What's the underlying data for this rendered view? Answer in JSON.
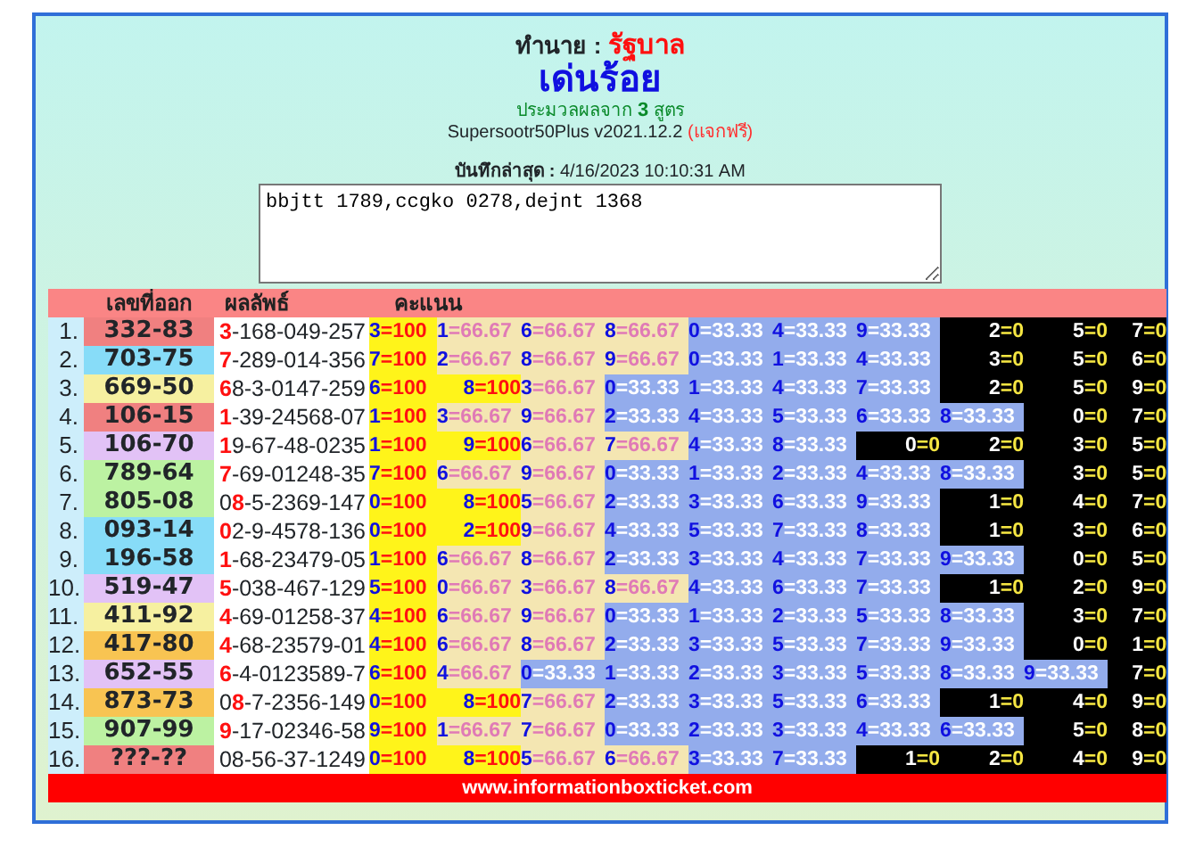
{
  "header": {
    "label": "ทำนาย :",
    "value": "รัฐบาล"
  },
  "title": "เด่นร้อย",
  "subtitle": "ประมวลผลจาก **3** สูตร",
  "version": "Supersootr50Plus v2021.12.2",
  "version_note": "(แจกฟรี)",
  "saved": {
    "label": "บันทึกล่าสุด :",
    "value": "4/16/2023 10:10:31 AM"
  },
  "notes": {
    "value": "bbjtt 1789,ccgko 0278,dejnt 1368"
  },
  "table": {
    "columns": [
      "เลขที่ออก",
      "ผลลัพธ์",
      "คะแนน"
    ],
    "rows": [
      {
        "index": "1.",
        "number": "332-83",
        "color": "#f08080",
        "result": "**3**-168-049-257",
        "scores": [
          {
            "text": "3=100",
            "kind": "full"
          },
          {
            "text": "1=66.67",
            "kind": "high"
          },
          {
            "text": "6=66.67",
            "kind": "high"
          },
          {
            "text": "8=66.67",
            "kind": "high"
          },
          {
            "text": "0=33.33",
            "kind": "mid"
          },
          {
            "text": "4=33.33",
            "kind": "mid"
          },
          {
            "text": "9=33.33",
            "kind": "mid"
          },
          {
            "text": "2=0",
            "kind": "zero"
          },
          {
            "text": "5=0",
            "kind": "zero"
          },
          {
            "text": "7=0",
            "kind": "zero"
          }
        ]
      },
      {
        "index": "2.",
        "number": "703-75",
        "color": "#87dcf8",
        "result": "**7**-289-014-356",
        "scores": [
          {
            "text": "7=100",
            "kind": "full"
          },
          {
            "text": "2=66.67",
            "kind": "high"
          },
          {
            "text": "8=66.67",
            "kind": "high"
          },
          {
            "text": "9=66.67",
            "kind": "high"
          },
          {
            "text": "0=33.33",
            "kind": "mid"
          },
          {
            "text": "1=33.33",
            "kind": "mid"
          },
          {
            "text": "4=33.33",
            "kind": "mid"
          },
          {
            "text": "3=0",
            "kind": "zero"
          },
          {
            "text": "5=0",
            "kind": "zero"
          },
          {
            "text": "6=0",
            "kind": "zero"
          }
        ]
      },
      {
        "index": "3.",
        "number": "669-50",
        "color": "#f6f0a0",
        "result": "**6**8-3-0147-259",
        "scores": [
          {
            "text": "6=100",
            "kind": "full"
          },
          {
            "text": "8=100",
            "kind": "full"
          },
          {
            "text": "3=66.67",
            "kind": "high"
          },
          {
            "text": "0=33.33",
            "kind": "mid"
          },
          {
            "text": "1=33.33",
            "kind": "mid"
          },
          {
            "text": "4=33.33",
            "kind": "mid"
          },
          {
            "text": "7=33.33",
            "kind": "mid"
          },
          {
            "text": "2=0",
            "kind": "zero"
          },
          {
            "text": "5=0",
            "kind": "zero"
          },
          {
            "text": "9=0",
            "kind": "zero"
          }
        ]
      },
      {
        "index": "4.",
        "number": "106-15",
        "color": "#f08080",
        "result": "**1**-39-24568-07",
        "scores": [
          {
            "text": "1=100",
            "kind": "full"
          },
          {
            "text": "3=66.67",
            "kind": "high"
          },
          {
            "text": "9=66.67",
            "kind": "high"
          },
          {
            "text": "2=33.33",
            "kind": "mid"
          },
          {
            "text": "4=33.33",
            "kind": "mid"
          },
          {
            "text": "5=33.33",
            "kind": "mid"
          },
          {
            "text": "6=33.33",
            "kind": "mid"
          },
          {
            "text": "8=33.33",
            "kind": "mid"
          },
          {
            "text": "0=0",
            "kind": "zero"
          },
          {
            "text": "7=0",
            "kind": "zero"
          }
        ]
      },
      {
        "index": "5.",
        "number": "106-70",
        "color": "#e2c2f6",
        "result": "**1**9-67-48-0235",
        "scores": [
          {
            "text": "1=100",
            "kind": "full"
          },
          {
            "text": "9=100",
            "kind": "full"
          },
          {
            "text": "6=66.67",
            "kind": "high"
          },
          {
            "text": "7=66.67",
            "kind": "high"
          },
          {
            "text": "4=33.33",
            "kind": "mid"
          },
          {
            "text": "8=33.33",
            "kind": "mid"
          },
          {
            "text": "0=0",
            "kind": "zero"
          },
          {
            "text": "2=0",
            "kind": "zero"
          },
          {
            "text": "3=0",
            "kind": "zero"
          },
          {
            "text": "5=0",
            "kind": "zero"
          }
        ]
      },
      {
        "index": "6.",
        "number": "789-64",
        "color": "#bcf2a2",
        "result": "**7**-69-01248-35",
        "scores": [
          {
            "text": "7=100",
            "kind": "full"
          },
          {
            "text": "6=66.67",
            "kind": "high"
          },
          {
            "text": "9=66.67",
            "kind": "high"
          },
          {
            "text": "0=33.33",
            "kind": "mid"
          },
          {
            "text": "1=33.33",
            "kind": "mid"
          },
          {
            "text": "2=33.33",
            "kind": "mid"
          },
          {
            "text": "4=33.33",
            "kind": "mid"
          },
          {
            "text": "8=33.33",
            "kind": "mid"
          },
          {
            "text": "3=0",
            "kind": "zero"
          },
          {
            "text": "5=0",
            "kind": "zero"
          }
        ]
      },
      {
        "index": "7.",
        "number": "805-08",
        "color": "#bcf2a2",
        "result": "0**8**-5-2369-147",
        "scores": [
          {
            "text": "0=100",
            "kind": "full"
          },
          {
            "text": "8=100",
            "kind": "full"
          },
          {
            "text": "5=66.67",
            "kind": "high"
          },
          {
            "text": "2=33.33",
            "kind": "mid"
          },
          {
            "text": "3=33.33",
            "kind": "mid"
          },
          {
            "text": "6=33.33",
            "kind": "mid"
          },
          {
            "text": "9=33.33",
            "kind": "mid"
          },
          {
            "text": "1=0",
            "kind": "zero"
          },
          {
            "text": "4=0",
            "kind": "zero"
          },
          {
            "text": "7=0",
            "kind": "zero"
          }
        ]
      },
      {
        "index": "8.",
        "number": "093-14",
        "color": "#87dcf8",
        "result": "**0**2-9-4578-136",
        "scores": [
          {
            "text": "0=100",
            "kind": "full"
          },
          {
            "text": "2=100",
            "kind": "full"
          },
          {
            "text": "9=66.67",
            "kind": "high"
          },
          {
            "text": "4=33.33",
            "kind": "mid"
          },
          {
            "text": "5=33.33",
            "kind": "mid"
          },
          {
            "text": "7=33.33",
            "kind": "mid"
          },
          {
            "text": "8=33.33",
            "kind": "mid"
          },
          {
            "text": "1=0",
            "kind": "zero"
          },
          {
            "text": "3=0",
            "kind": "zero"
          },
          {
            "text": "6=0",
            "kind": "zero"
          }
        ]
      },
      {
        "index": "9.",
        "number": "196-58",
        "color": "#87dcf8",
        "result": "**1**-68-23479-05",
        "scores": [
          {
            "text": "1=100",
            "kind": "full"
          },
          {
            "text": "6=66.67",
            "kind": "high"
          },
          {
            "text": "8=66.67",
            "kind": "high"
          },
          {
            "text": "2=33.33",
            "kind": "mid"
          },
          {
            "text": "3=33.33",
            "kind": "mid"
          },
          {
            "text": "4=33.33",
            "kind": "mid"
          },
          {
            "text": "7=33.33",
            "kind": "mid"
          },
          {
            "text": "9=33.33",
            "kind": "mid"
          },
          {
            "text": "0=0",
            "kind": "zero"
          },
          {
            "text": "5=0",
            "kind": "zero"
          }
        ]
      },
      {
        "index": "10.",
        "number": "519-47",
        "color": "#e2c2f6",
        "result": "**5**-038-467-129",
        "scores": [
          {
            "text": "5=100",
            "kind": "full"
          },
          {
            "text": "0=66.67",
            "kind": "high"
          },
          {
            "text": "3=66.67",
            "kind": "high"
          },
          {
            "text": "8=66.67",
            "kind": "high"
          },
          {
            "text": "4=33.33",
            "kind": "mid"
          },
          {
            "text": "6=33.33",
            "kind": "mid"
          },
          {
            "text": "7=33.33",
            "kind": "mid"
          },
          {
            "text": "1=0",
            "kind": "zero"
          },
          {
            "text": "2=0",
            "kind": "zero"
          },
          {
            "text": "9=0",
            "kind": "zero"
          }
        ]
      },
      {
        "index": "11.",
        "number": "411-92",
        "color": "#f6f0a0",
        "result": "**4**-69-01258-37",
        "scores": [
          {
            "text": "4=100",
            "kind": "full"
          },
          {
            "text": "6=66.67",
            "kind": "high"
          },
          {
            "text": "9=66.67",
            "kind": "high"
          },
          {
            "text": "0=33.33",
            "kind": "mid"
          },
          {
            "text": "1=33.33",
            "kind": "mid"
          },
          {
            "text": "2=33.33",
            "kind": "mid"
          },
          {
            "text": "5=33.33",
            "kind": "mid"
          },
          {
            "text": "8=33.33",
            "kind": "mid"
          },
          {
            "text": "3=0",
            "kind": "zero"
          },
          {
            "text": "7=0",
            "kind": "zero"
          }
        ]
      },
      {
        "index": "12.",
        "number": "417-80",
        "color": "#f8c452",
        "result": "**4**-68-23579-01",
        "scores": [
          {
            "text": "4=100",
            "kind": "full"
          },
          {
            "text": "6=66.67",
            "kind": "high"
          },
          {
            "text": "8=66.67",
            "kind": "high"
          },
          {
            "text": "2=33.33",
            "kind": "mid"
          },
          {
            "text": "3=33.33",
            "kind": "mid"
          },
          {
            "text": "5=33.33",
            "kind": "mid"
          },
          {
            "text": "7=33.33",
            "kind": "mid"
          },
          {
            "text": "9=33.33",
            "kind": "mid"
          },
          {
            "text": "0=0",
            "kind": "zero"
          },
          {
            "text": "1=0",
            "kind": "zero"
          }
        ]
      },
      {
        "index": "13.",
        "number": "652-55",
        "color": "#e2c2f6",
        "result": "**6**-4-0123589-7",
        "scores": [
          {
            "text": "6=100",
            "kind": "full"
          },
          {
            "text": "4=66.67",
            "kind": "high"
          },
          {
            "text": "0=33.33",
            "kind": "mid"
          },
          {
            "text": "1=33.33",
            "kind": "mid"
          },
          {
            "text": "2=33.33",
            "kind": "mid"
          },
          {
            "text": "3=33.33",
            "kind": "mid"
          },
          {
            "text": "5=33.33",
            "kind": "mid"
          },
          {
            "text": "8=33.33",
            "kind": "mid"
          },
          {
            "text": "9=33.33",
            "kind": "mid"
          },
          {
            "text": "7=0",
            "kind": "zero"
          }
        ]
      },
      {
        "index": "14.",
        "number": "873-73",
        "color": "#f8c452",
        "result": "0**8**-7-2356-149",
        "scores": [
          {
            "text": "0=100",
            "kind": "full"
          },
          {
            "text": "8=100",
            "kind": "full"
          },
          {
            "text": "7=66.67",
            "kind": "high"
          },
          {
            "text": "2=33.33",
            "kind": "mid"
          },
          {
            "text": "3=33.33",
            "kind": "mid"
          },
          {
            "text": "5=33.33",
            "kind": "mid"
          },
          {
            "text": "6=33.33",
            "kind": "mid"
          },
          {
            "text": "1=0",
            "kind": "zero"
          },
          {
            "text": "4=0",
            "kind": "zero"
          },
          {
            "text": "9=0",
            "kind": "zero"
          }
        ]
      },
      {
        "index": "15.",
        "number": "907-99",
        "color": "#bcf2a2",
        "result": "**9**-17-02346-58",
        "scores": [
          {
            "text": "9=100",
            "kind": "full"
          },
          {
            "text": "1=66.67",
            "kind": "high"
          },
          {
            "text": "7=66.67",
            "kind": "high"
          },
          {
            "text": "0=33.33",
            "kind": "mid"
          },
          {
            "text": "2=33.33",
            "kind": "mid"
          },
          {
            "text": "3=33.33",
            "kind": "mid"
          },
          {
            "text": "4=33.33",
            "kind": "mid"
          },
          {
            "text": "6=33.33",
            "kind": "mid"
          },
          {
            "text": "5=0",
            "kind": "zero"
          },
          {
            "text": "8=0",
            "kind": "zero"
          }
        ]
      },
      {
        "index": "16.",
        "number": "???-??",
        "color": "#f08080",
        "result": "08-56-37-1249",
        "scores": [
          {
            "text": "0=100",
            "kind": "full"
          },
          {
            "text": "8=100",
            "kind": "full"
          },
          {
            "text": "5=66.67",
            "kind": "high"
          },
          {
            "text": "6=66.67",
            "kind": "high"
          },
          {
            "text": "3=33.33",
            "kind": "mid"
          },
          {
            "text": "7=33.33",
            "kind": "mid"
          },
          {
            "text": "1=0",
            "kind": "zero"
          },
          {
            "text": "2=0",
            "kind": "zero"
          },
          {
            "text": "4=0",
            "kind": "zero"
          },
          {
            "text": "9=0",
            "kind": "zero"
          }
        ]
      }
    ]
  },
  "footer": "www.informationboxticket.com"
}
